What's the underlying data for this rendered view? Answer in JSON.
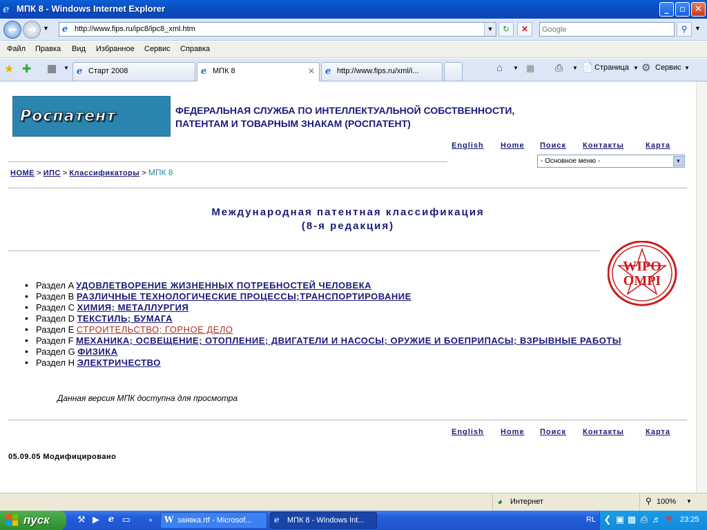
{
  "window": {
    "title": "МПК 8 - Windows Internet Explorer",
    "buttons": {
      "minimize": "_",
      "maximize": "▫",
      "close": "✕"
    }
  },
  "address_bar": {
    "url": "http://www.fips.ru/ipc8/ipc8_xml.htm",
    "search_placeholder": "Google"
  },
  "menu": [
    "Файл",
    "Правка",
    "Вид",
    "Избранное",
    "Сервис",
    "Справка"
  ],
  "tabs": [
    {
      "label": "Старт 2008"
    },
    {
      "label": "МПК 8"
    },
    {
      "label": "http://www.fips.ru/xml/i..."
    }
  ],
  "command_bar": {
    "page": "Страница",
    "tools": "Сервис"
  },
  "page": {
    "logo_text": "Роспатент",
    "agency_line1": "ФЕДЕРАЛЬНАЯ СЛУЖБА ПО ИНТЕЛЛЕКТУАЛЬНОЙ СОБСТВЕННОСТИ,",
    "agency_line2": "ПАТЕНТАМ И ТОВАРНЫМ ЗНАКАМ (РОСПАТЕНТ)",
    "top_links": [
      "English",
      "Home",
      "Поиск",
      "Контакты",
      "Карта"
    ],
    "main_menu_select": "- Основное меню -",
    "breadcrumb": {
      "home": "HOME",
      "sep": ">",
      "ips": "ИПС",
      "classifiers": "Классификаторы",
      "current": "МПК 8"
    },
    "heading_line1": "Международная патентная классификация",
    "heading_line2": "(8-я редакция)",
    "seal_text": "WIPO OMPI",
    "sections": [
      {
        "prefix": "Раздел A",
        "title": "УДОВЛЕТВОРЕНИЕ ЖИЗНЕННЫХ ПОТРЕБНОСТЕЙ ЧЕЛОВЕКА"
      },
      {
        "prefix": "Раздел B",
        "title": "РАЗЛИЧНЫЕ ТЕХНОЛОГИЧЕСКИЕ ПРОЦЕССЫ;ТРАНСПОРТИРОВАНИЕ"
      },
      {
        "prefix": "Раздел C",
        "title": "ХИМИЯ; МЕТАЛЛУРГИЯ"
      },
      {
        "prefix": "Раздел D",
        "title": "ТЕКСТИЛЬ; БУМАГА"
      },
      {
        "prefix": "Раздел E",
        "title": "СТРОИТЕЛЬСТВО; ГОРНОЕ ДЕЛО"
      },
      {
        "prefix": "Раздел F",
        "title": "МЕХАНИКА; ОСВЕЩЕНИЕ; ОТОПЛЕНИЕ; ДВИГАТЕЛИ И НАСОСЫ; ОРУЖИЕ И БОЕПРИПАСЫ; ВЗРЫВНЫЕ РАБОТЫ"
      },
      {
        "prefix": "Раздел G",
        "title": "ФИЗИКА"
      },
      {
        "prefix": "Раздел H",
        "title": "ЭЛЕКТРИЧЕСТВО"
      }
    ],
    "note": "Данная версия МПК доступна для просмотра",
    "modified": "05.09.05 Модифицировано"
  },
  "status_bar": {
    "zone": "Интернет",
    "zoom": "100%"
  },
  "taskbar": {
    "start": "пуск",
    "tasks": [
      "заявка.rtf - Microsof...",
      "МПК 8 - Windows Int..."
    ],
    "lang": "RL",
    "clock": "23:25"
  },
  "colors": {
    "link": "#1a1a7a",
    "visited_link": "#b03020",
    "logo_bg": "#2a86b0",
    "seal": "#cc1b1b"
  }
}
